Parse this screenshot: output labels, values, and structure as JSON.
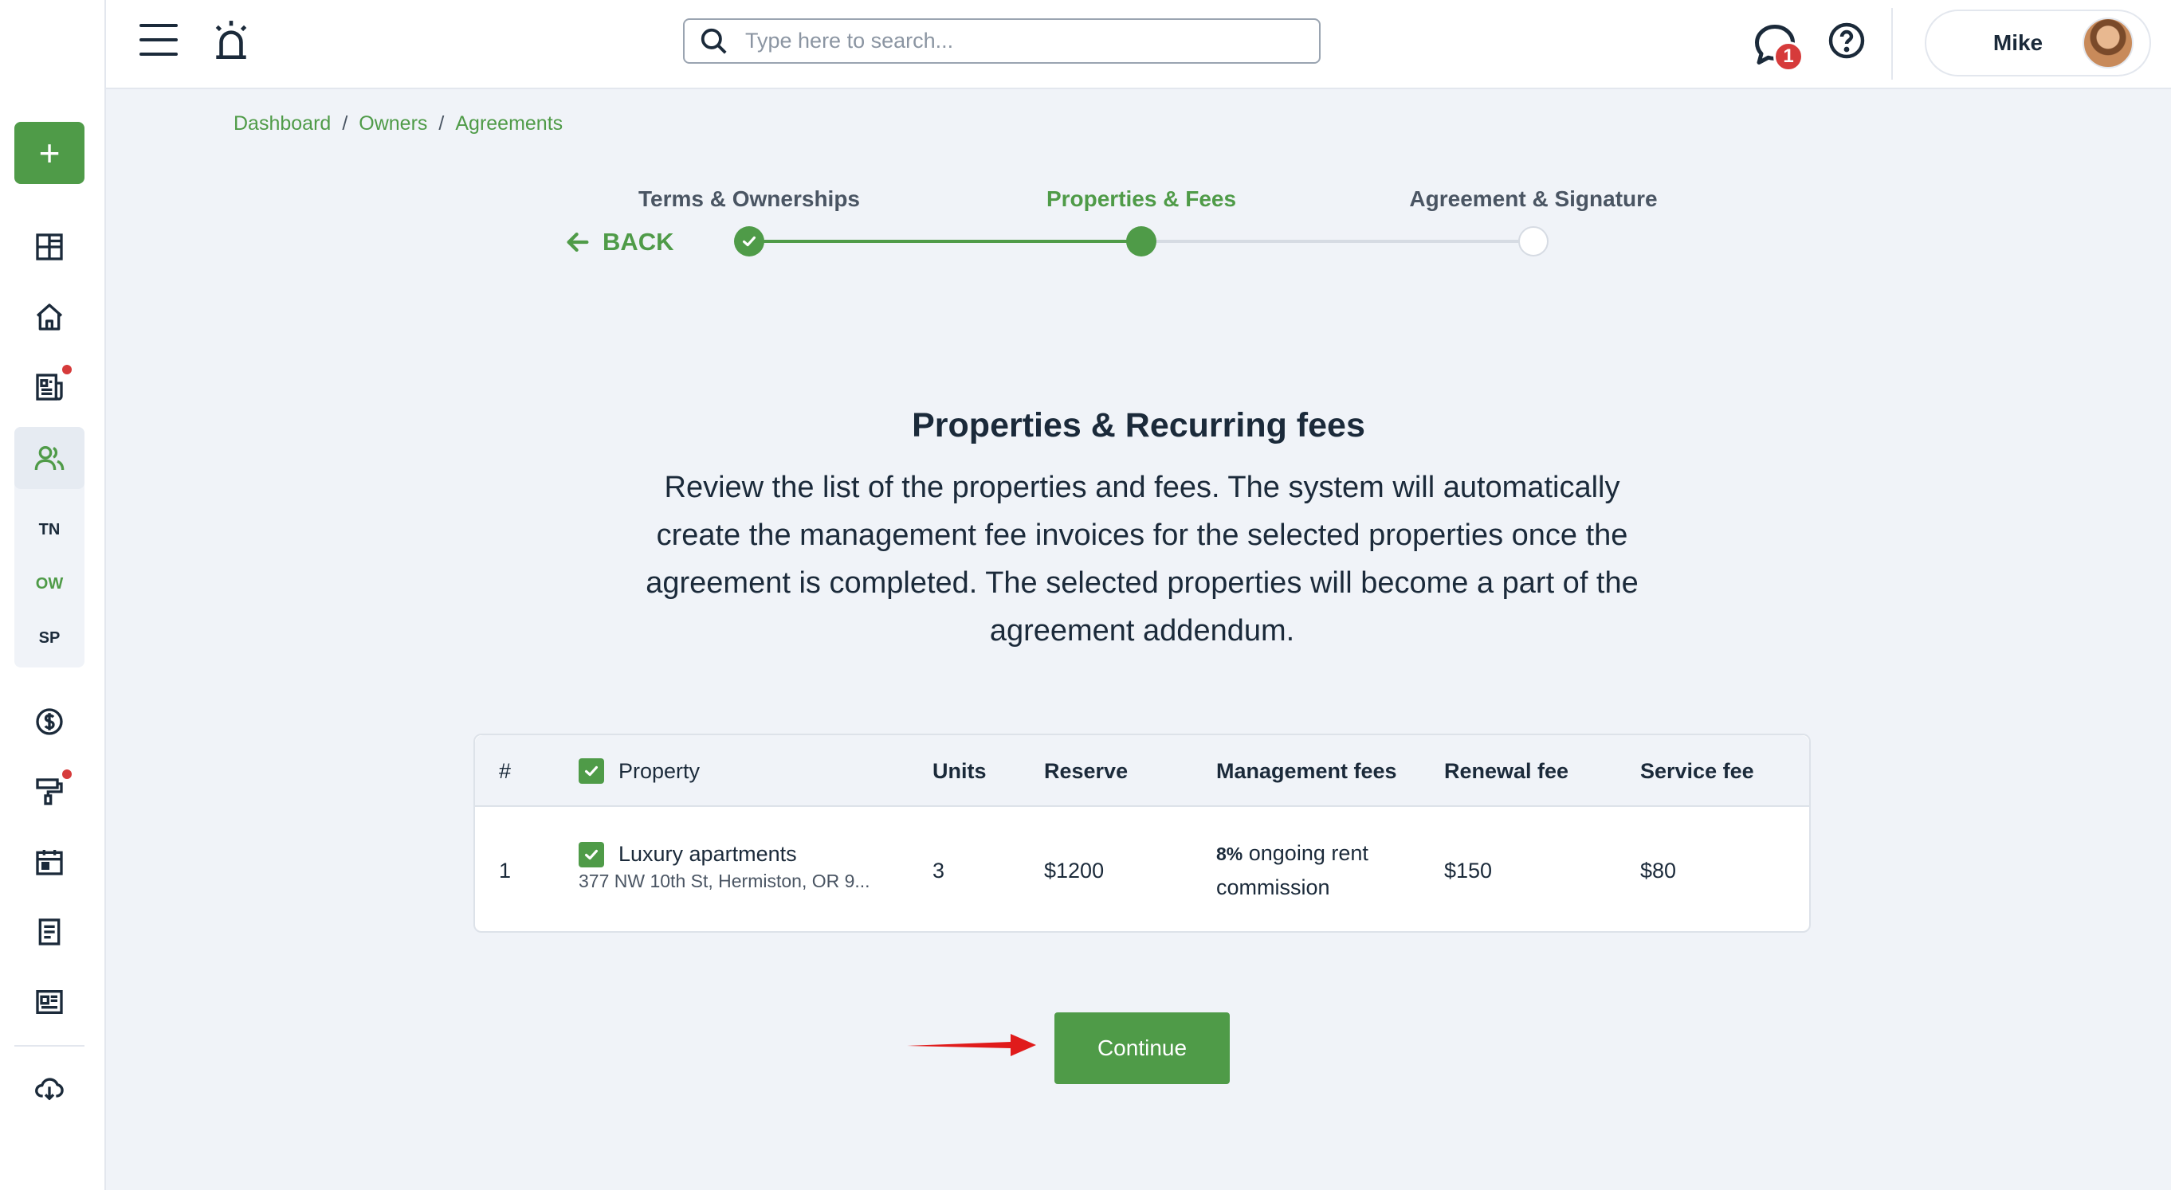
{
  "sidebar": {
    "add_label": "+",
    "sub_items": [
      "TN",
      "OW",
      "SP"
    ],
    "active_sub": "OW"
  },
  "topbar": {
    "search_placeholder": "Type here to search...",
    "chat_badge": "1",
    "user_name": "Mike"
  },
  "breadcrumb": [
    "Dashboard",
    "Owners",
    "Agreements"
  ],
  "stepper": {
    "back_label": "BACK",
    "steps": [
      {
        "label": "Terms & Ownerships",
        "state": "done"
      },
      {
        "label": "Properties & Fees",
        "state": "current"
      },
      {
        "label": "Agreement & Signature",
        "state": "todo"
      }
    ]
  },
  "main": {
    "title": "Properties & Recurring fees",
    "description": "Review the list of the properties and fees. The system will automatically create the management fee invoices for the selected properties once the agreement is completed. The selected properties will become a part of the agreement addendum."
  },
  "table": {
    "headers": {
      "num": "#",
      "property": "Property",
      "units": "Units",
      "reserve": "Reserve",
      "management": "Management fees",
      "renewal": "Renewal fee",
      "service": "Service fee"
    },
    "rows": [
      {
        "num": "1",
        "name": "Luxury apartments",
        "address": "377 NW 10th St, Hermiston, OR 9...",
        "units": "3",
        "reserve": "$1200",
        "mgmt_pct": "8%",
        "mgmt_text": " ongoing rent commission",
        "renewal": "$150",
        "service": "$80"
      }
    ]
  },
  "continue_label": "Continue",
  "colors": {
    "accent": "#4f9b48",
    "badge": "#d63b3b",
    "annotation_arrow": "#e01b1b"
  }
}
